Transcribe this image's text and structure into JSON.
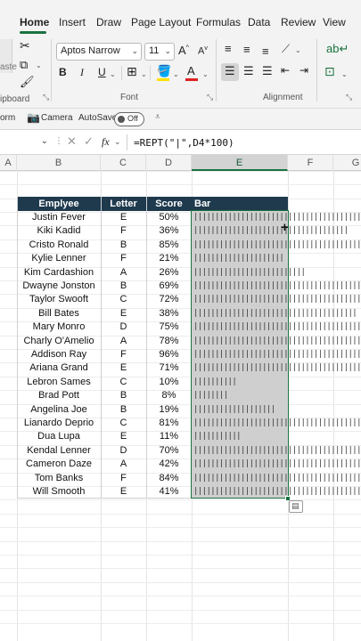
{
  "menu": {
    "tabs": [
      "Home",
      "Insert",
      "Draw",
      "Page Layout",
      "Formulas",
      "Data",
      "Review",
      "View"
    ],
    "active": "Home"
  },
  "ribbon": {
    "clipboard": {
      "label": "ipboard",
      "paste_label": "aste"
    },
    "font": {
      "name": "Aptos Narrow",
      "size": "11",
      "bold": "B",
      "italic": "I",
      "underline": "U",
      "grow": "A",
      "shrink": "A",
      "font_color": "A",
      "label": "Font"
    },
    "alignment": {
      "label": "Alignment"
    }
  },
  "toolbar2": {
    "form_label": "orm",
    "camera_label": "Camera",
    "autosave_label": "AutoSave",
    "autosave_state": "Off"
  },
  "formula_bar": {
    "fx": "fx",
    "formula": "=REPT(\"|\",D4*100)"
  },
  "columns": [
    "A",
    "B",
    "C",
    "D",
    "E",
    "F",
    "G"
  ],
  "selected_column": "E",
  "table": {
    "headers": [
      "Emplyee",
      "Letter",
      "Score",
      "Bar"
    ],
    "rows": [
      {
        "name": "Justin Fever",
        "letter": "E",
        "score": "50%",
        "bar": "||||||||||||||||||||||||||||||||||||||||||||||||||"
      },
      {
        "name": "Kiki Kadid",
        "letter": "F",
        "score": "36%",
        "bar": "||||||||||||||||||||||||||||||||||||"
      },
      {
        "name": "Cristo Ronald",
        "letter": "B",
        "score": "85%",
        "bar": "|||||||||||||||||||||||||||||||||||||||||||||||||||||||||||||||||||||||||||||||||||||"
      },
      {
        "name": "Kylie Lenner",
        "letter": "F",
        "score": "21%",
        "bar": "|||||||||||||||||||||"
      },
      {
        "name": "Kim Cardashion",
        "letter": "A",
        "score": "26%",
        "bar": "||||||||||||||||||||||||||"
      },
      {
        "name": "Dwayne Jonston",
        "letter": "B",
        "score": "69%",
        "bar": "|||||||||||||||||||||||||||||||||||||||||||||||||||||||||||||||||||||"
      },
      {
        "name": "Taylor Swooft",
        "letter": "C",
        "score": "72%",
        "bar": "||||||||||||||||||||||||||||||||||||||||||||||||||||||||||||||||||||||||"
      },
      {
        "name": "Bill Bates",
        "letter": "E",
        "score": "38%",
        "bar": "||||||||||||||||||||||||||||||||||||||"
      },
      {
        "name": "Mary Monro",
        "letter": "D",
        "score": "75%",
        "bar": "|||||||||||||||||||||||||||||||||||||||||||||||||||||||||||||||||||||||||||"
      },
      {
        "name": "Charly O'Amelio",
        "letter": "A",
        "score": "78%",
        "bar": "||||||||||||||||||||||||||||||||||||||||||||||||||||||||||||||||||||||||||||||"
      },
      {
        "name": "Addison Ray",
        "letter": "F",
        "score": "96%",
        "bar": "||||||||||||||||||||||||||||||||||||||||||||||||||||||||||||||||||||||||||||||||||||||||||||||||"
      },
      {
        "name": "Ariana Grand",
        "letter": "E",
        "score": "71%",
        "bar": "|||||||||||||||||||||||||||||||||||||||||||||||||||||||||||||||||||||||"
      },
      {
        "name": "Lebron Sames",
        "letter": "C",
        "score": "10%",
        "bar": "||||||||||"
      },
      {
        "name": "Brad Pott",
        "letter": "B",
        "score": "8%",
        "bar": "||||||||"
      },
      {
        "name": "Angelina Joe",
        "letter": "B",
        "score": "19%",
        "bar": "|||||||||||||||||||"
      },
      {
        "name": "Lianardo Deprio",
        "letter": "C",
        "score": "81%",
        "bar": "|||||||||||||||||||||||||||||||||||||||||||||||||||||||||||||||||||||||||||||||||"
      },
      {
        "name": "Dua Lupa",
        "letter": "E",
        "score": "11%",
        "bar": "|||||||||||"
      },
      {
        "name": "Kendal Lenner",
        "letter": "D",
        "score": "70%",
        "bar": "||||||||||||||||||||||||||||||||||||||||||||||||||||||||||||||||||||||"
      },
      {
        "name": "Cameron Daze",
        "letter": "A",
        "score": "42%",
        "bar": "||||||||||||||||||||||||||||||||||||||||||"
      },
      {
        "name": "Tom Banks",
        "letter": "F",
        "score": "84%",
        "bar": "||||||||||||||||||||||||||||||||||||||||||||||||||||||||||||||||||||||||||||||||||||"
      },
      {
        "name": "Will Smooth",
        "letter": "E",
        "score": "41%",
        "bar": "|||||||||||||||||||||||||||||||||||||||||"
      }
    ]
  },
  "colors": {
    "accent": "#1a7340",
    "header_fill": "#1f3a4d",
    "selection_fill": "#cfcfcf"
  }
}
